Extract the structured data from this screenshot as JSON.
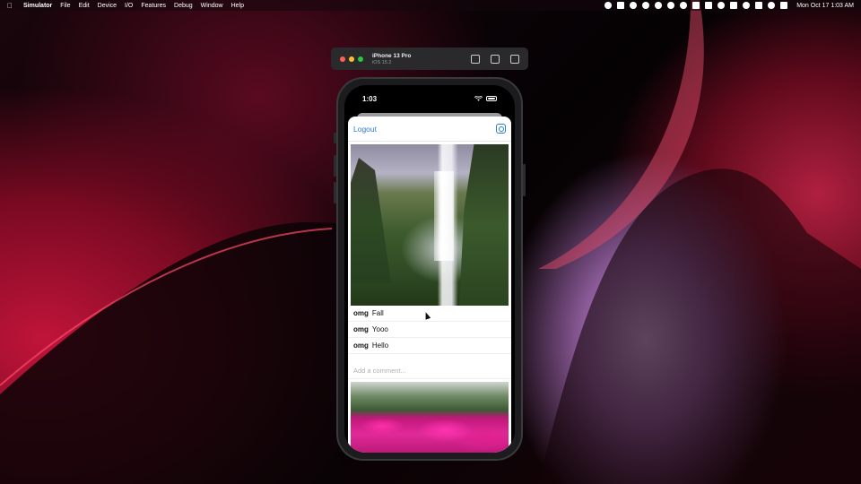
{
  "menubar": {
    "app_name": "Simulator",
    "items": [
      "File",
      "Edit",
      "Device",
      "I/O",
      "Features",
      "Debug",
      "Window",
      "Help"
    ],
    "clock": "Mon Oct 17  1:03 AM"
  },
  "simulator": {
    "device_name": "iPhone 13 Pro",
    "os_version": "iOS 15.2"
  },
  "phone": {
    "status_time": "1:03",
    "nav": {
      "logout_label": "Logout"
    },
    "post1": {
      "comments": [
        {
          "user": "omg",
          "text": "Fall"
        },
        {
          "user": "omg",
          "text": "Yooo"
        },
        {
          "user": "omg",
          "text": "Hello"
        }
      ],
      "comment_placeholder": "Add a comment..."
    }
  },
  "colors": {
    "accent": "#2b7bd6",
    "traffic_red": "#ff5f57",
    "traffic_yellow": "#febc2e",
    "traffic_green": "#28c840"
  },
  "icons": [
    "apple-icon",
    "home-icon",
    "screenshot-icon",
    "rotate-icon",
    "wifi-icon",
    "battery-icon",
    "camera-icon"
  ]
}
